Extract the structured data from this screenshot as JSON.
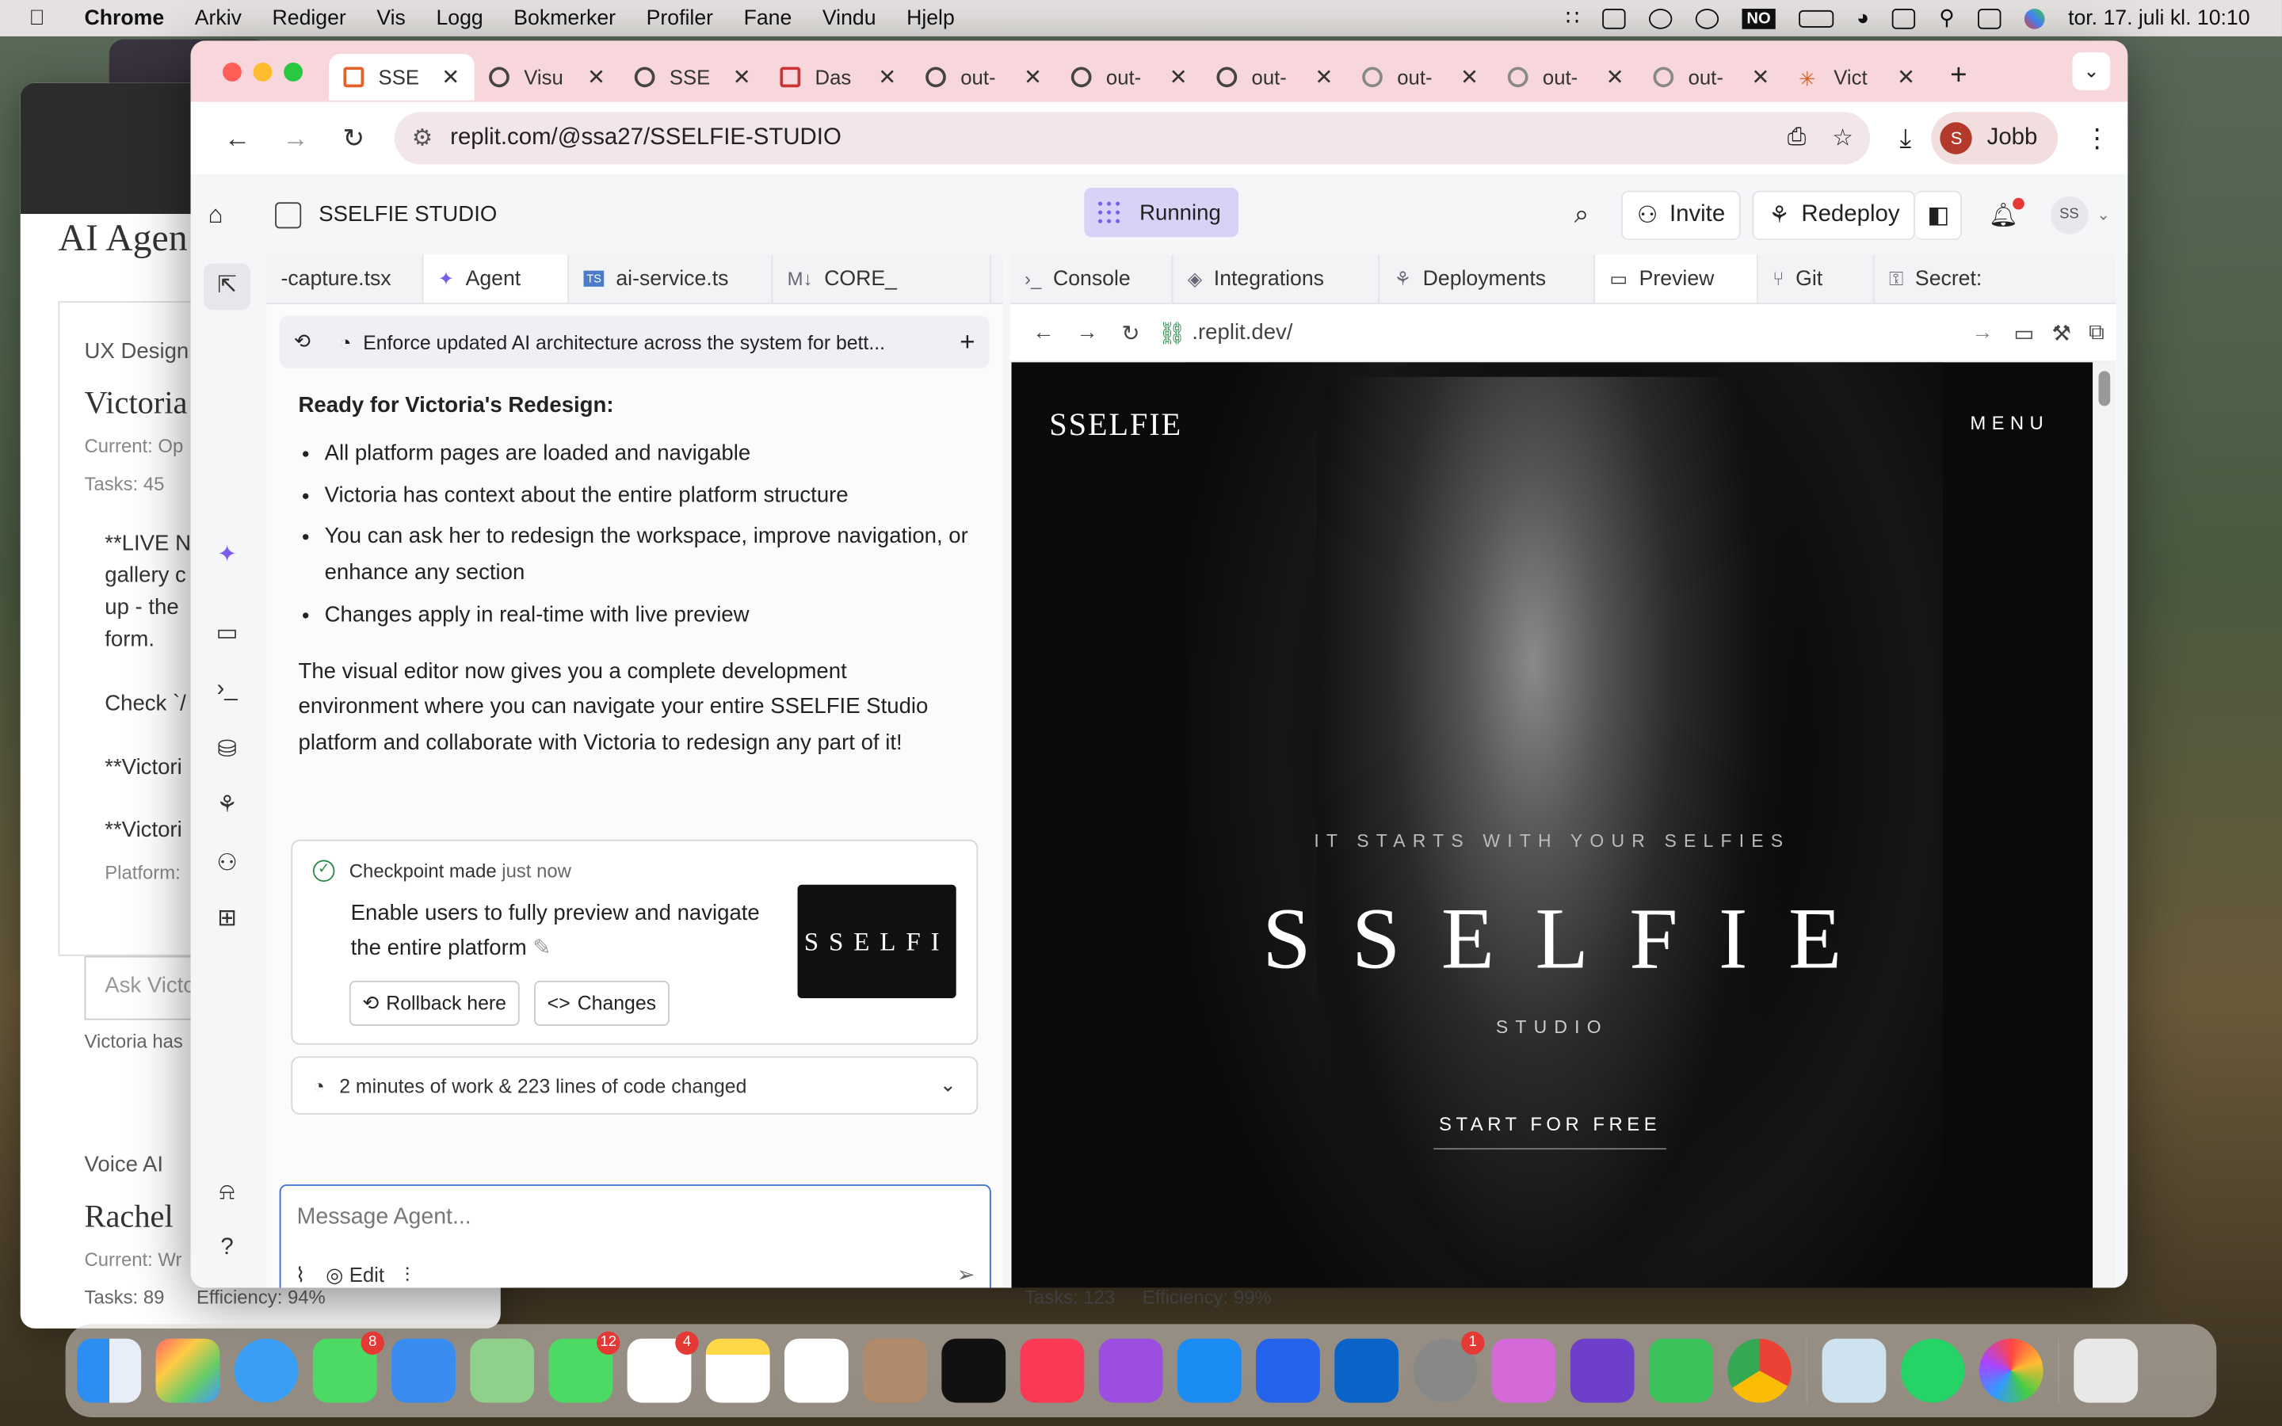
{
  "menubar": {
    "app": "Chrome",
    "items": [
      "Arkiv",
      "Rediger",
      "Vis",
      "Logg",
      "Bokmerker",
      "Profiler",
      "Fane",
      "Vindu",
      "Hjelp"
    ],
    "kb": "NO",
    "clock": "tor. 17. juli kl. 10:10"
  },
  "bgwin": {
    "title": "AI Agen",
    "l1": "UX Design",
    "l2": "Victoria",
    "l3": "Current: Op",
    "l4": "Tasks: 45",
    "c1": "**LIVE N",
    "c2": "gallery c",
    "c3": "up - the",
    "c4": "form.",
    "c5": "Check `/",
    "c6": "**Victori",
    "c7": "**Victori",
    "c8": "Platform:",
    "ask": "Ask Victo",
    "has": "Victoria has",
    "v1": "Voice AI",
    "v2": "Rachel",
    "v3": "Current: Wr",
    "v4": "Tasks: 89",
    "v5": "Efficiency: 94%",
    "v6": "Tasks: 123",
    "v7": "Efficiency: 99%"
  },
  "tabs": [
    "SSE",
    "Visu",
    "SSE",
    "Das",
    "out-",
    "out-",
    "out-",
    "out-",
    "out-",
    "out-",
    "Vict"
  ],
  "url": "replit.com/@ssa27/SSELFIE-STUDIO",
  "profile": {
    "initial": "S",
    "name": "Jobb"
  },
  "replit": {
    "title": "SSELFIE STUDIO",
    "running": "Running",
    "invite": "Invite",
    "redeploy": "Redeploy",
    "avatar": "SS"
  },
  "leftTabs": [
    "-capture.tsx",
    "Agent",
    "ai-service.ts",
    "CORE_"
  ],
  "history": "Enforce updated AI architecture across the system for bett...",
  "message": {
    "heading": "Ready for Victoria's Redesign:",
    "bullets": [
      "All platform pages are loaded and navigable",
      "Victoria has context about the entire platform structure",
      "You can ask her to redesign the workspace, improve navigation, or enhance any section",
      "Changes apply in real-time with live preview"
    ],
    "para": "The visual editor now gives you a complete development environment where you can navigate your entire SSELFIE Studio platform and collaborate with Victoria to redesign any part of it!"
  },
  "checkpoint": {
    "meta": "Checkpoint made",
    "when": "just now",
    "desc": "Enable users to fully preview and navigate the entire platform",
    "rollback": "Rollback here",
    "changes": "Changes",
    "thumb": "SSELFI"
  },
  "work": "2 minutes of work & 223 lines of code changed",
  "input": {
    "placeholder": "Message Agent...",
    "edit": "Edit"
  },
  "rightTabs": [
    "Console",
    "Integrations",
    "Deployments",
    "Preview",
    "Git",
    "Secret:"
  ],
  "preview": {
    "url": ".replit.dev/",
    "logo": "SSELFIE",
    "menu": "MENU",
    "tag": "IT STARTS WITH YOUR SELFIES",
    "big": "SSELFIE",
    "studio": "STUDIO",
    "cta": "START FOR FREE"
  },
  "dock": {
    "badges": {
      "messages": "8",
      "facetime": "12",
      "reminders": "4",
      "settings": "1"
    }
  }
}
